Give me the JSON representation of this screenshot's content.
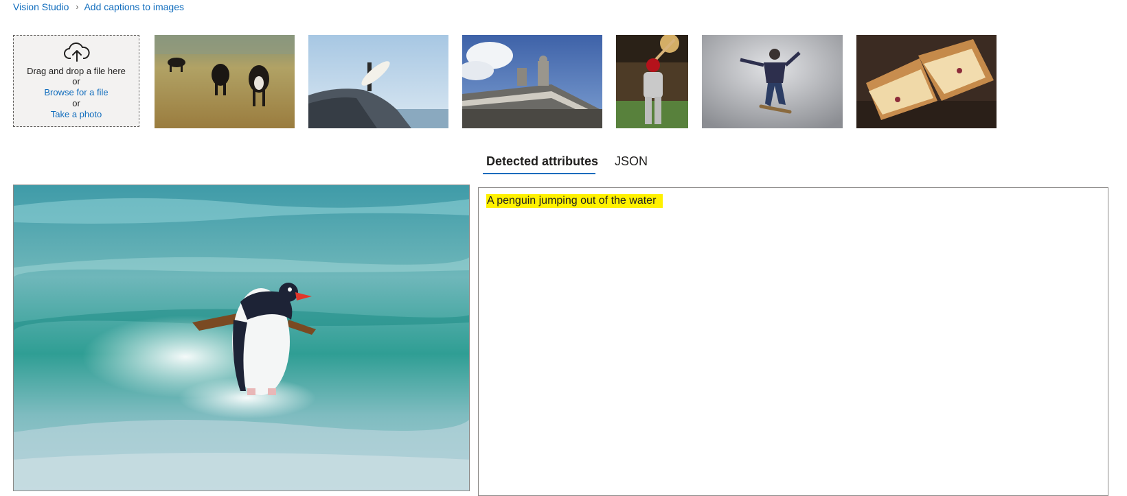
{
  "breadcrumb": {
    "root": "Vision Studio",
    "current": "Add captions to images",
    "separator": "›"
  },
  "upload": {
    "drag_text": "Drag and drop a file here",
    "or_1": "or",
    "browse_label": "Browse for a file",
    "or_2": "or",
    "photo_label": "Take a photo"
  },
  "samples": [
    {
      "subject": "cows grazing"
    },
    {
      "subject": "surfer on rock"
    },
    {
      "subject": "building statues"
    },
    {
      "subject": "baseball batter"
    },
    {
      "subject": "skateboarder"
    },
    {
      "subject": "grilled sandwich"
    }
  ],
  "tabs": [
    "Detected attributes",
    "JSON"
  ],
  "active_tab": "Detected attributes",
  "result": {
    "caption": "A penguin jumping out of the water"
  },
  "colors": {
    "link": "#0f6cbd",
    "highlight": "#fff100",
    "tab_underline": "#0f6cbd"
  }
}
